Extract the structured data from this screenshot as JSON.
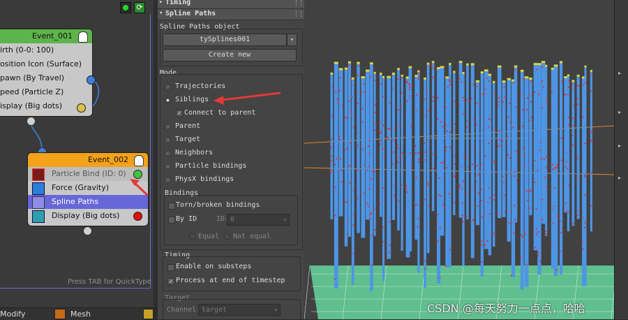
{
  "graph": {
    "event1": {
      "title": "Event_001",
      "operators": [
        "irth (0-0: 100)",
        "osition Icon (Surface)",
        "pawn (By Travel)",
        "peed (Particle Z)",
        "isplay (Big dots)"
      ]
    },
    "event2": {
      "title": "Event_002",
      "operators": [
        {
          "label": "Particle Bind (ID: 0)",
          "icon": "particle-bind-icon",
          "dot_color": "#3ec63e",
          "selected": false
        },
        {
          "label": "Force (Gravity)",
          "icon": "force-icon",
          "dot_color": null,
          "selected": false
        },
        {
          "label": "Spline Paths",
          "icon": "spline-paths-icon",
          "dot_color": null,
          "selected": true
        },
        {
          "label": "Display (Big dots)",
          "icon": "display-icon",
          "dot_color": "#e01010",
          "selected": false
        }
      ]
    },
    "quicktype_hint": "Press TAB for QuickType",
    "status_items": [
      "Modify",
      "Mesh"
    ]
  },
  "panel": {
    "rollup_timing": "Timing",
    "rollup_spline": "Spline Paths",
    "spline_object_label": "Spline Paths object",
    "spline_object_value": "tySplines001",
    "create_new": "Create new",
    "mode_label": "Mode",
    "modes": [
      {
        "label": "Trajectories",
        "selected": false
      },
      {
        "label": "Siblings",
        "selected": true
      },
      {
        "label": "Parent",
        "selected": false
      },
      {
        "label": "Target",
        "selected": false
      },
      {
        "label": "Neighbors",
        "selected": false
      },
      {
        "label": "Particle bindings",
        "selected": false
      },
      {
        "label": "PhysX bindings",
        "selected": false
      }
    ],
    "connect_to_parent": "Connect to parent",
    "bindings_label": "Bindings",
    "torn_broken": "Torn/broken bindings",
    "by_id": "By ID",
    "id_label": "ID:",
    "id_value": "0",
    "equal": "Equal",
    "not_equal": "Not equal",
    "timing_label": "Timing",
    "enable_substeps": "Enable on substeps",
    "process_end": "Process at end of timestep",
    "target_label": "Target",
    "channel_label": "Channel:",
    "channel_value": "target"
  },
  "watermark": "CSDN @每天努力一点点，哈哈",
  "colors": {
    "accent_green": "#5db44a",
    "accent_orange": "#f4a21a",
    "selected_blue": "#6767d8",
    "particle_blue": "#4e95e6"
  }
}
